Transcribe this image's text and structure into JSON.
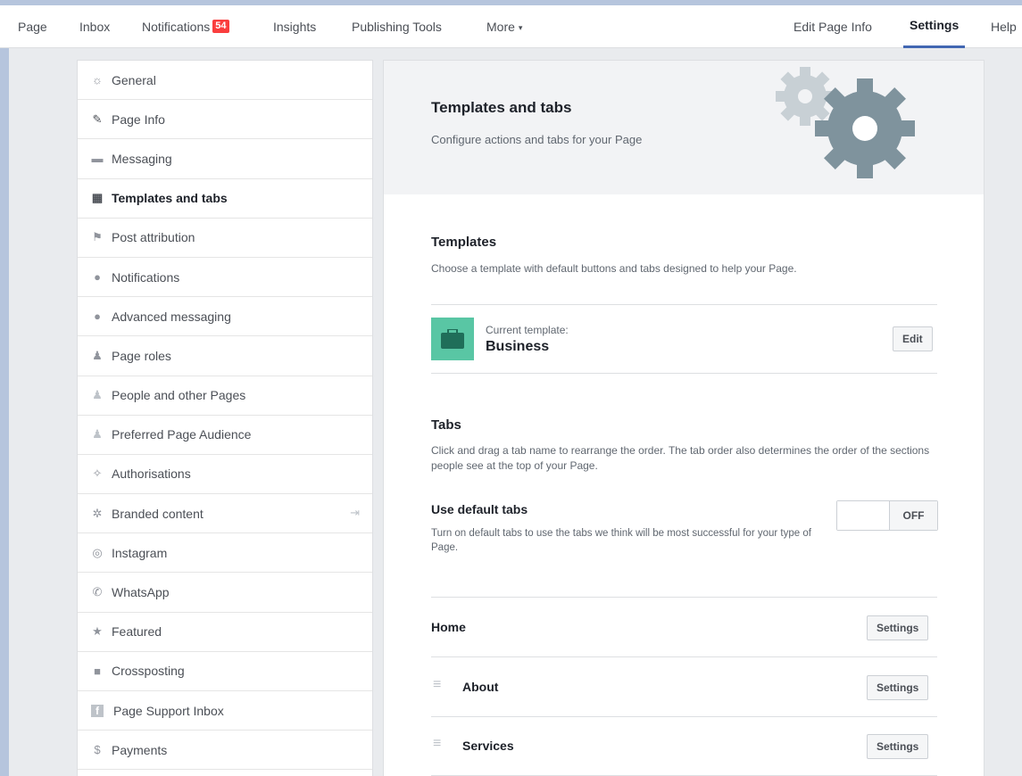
{
  "topnav": {
    "left": [
      {
        "label": "Page"
      },
      {
        "label": "Inbox"
      },
      {
        "label": "Notifications",
        "badge": "54"
      },
      {
        "label": "Insights"
      },
      {
        "label": "Publishing Tools"
      },
      {
        "label": "More"
      }
    ],
    "right": [
      {
        "label": "Edit Page Info"
      },
      {
        "label": "Settings"
      },
      {
        "label": "Help"
      }
    ],
    "more_caret": "▾"
  },
  "sidebar": {
    "items": [
      {
        "label": "General",
        "icon": "gear-icon",
        "glyph": "☼"
      },
      {
        "label": "Page Info",
        "icon": "pencil-icon",
        "glyph": "✎"
      },
      {
        "label": "Messaging",
        "icon": "messaging-icon",
        "glyph": "▬"
      },
      {
        "label": "Templates and tabs",
        "icon": "grid-icon",
        "glyph": "▦"
      },
      {
        "label": "Post attribution",
        "icon": "flag-icon",
        "glyph": "⚑"
      },
      {
        "label": "Notifications",
        "icon": "globe-icon",
        "glyph": "●"
      },
      {
        "label": "Advanced messaging",
        "icon": "messenger-icon",
        "glyph": "●"
      },
      {
        "label": "Page roles",
        "icon": "person-icon",
        "glyph": "♟"
      },
      {
        "label": "People and other Pages",
        "icon": "people-icon",
        "glyph": "♟"
      },
      {
        "label": "Preferred Page Audience",
        "icon": "audience-icon",
        "glyph": "♟"
      },
      {
        "label": "Authorisations",
        "icon": "wrench-icon",
        "glyph": "✧"
      },
      {
        "label": "Branded content",
        "icon": "handshake-icon",
        "glyph": "✲"
      },
      {
        "label": "Instagram",
        "icon": "instagram-icon",
        "glyph": "◎"
      },
      {
        "label": "WhatsApp",
        "icon": "whatsapp-icon",
        "glyph": "✆"
      },
      {
        "label": "Featured",
        "icon": "star-icon",
        "glyph": "★"
      },
      {
        "label": "Crossposting",
        "icon": "video-icon",
        "glyph": "■"
      },
      {
        "label": "Page Support Inbox",
        "icon": "facebook-icon",
        "glyph": "f"
      },
      {
        "label": "Payments",
        "icon": "dollar-icon",
        "glyph": "$"
      }
    ],
    "branded_extra_glyph": "⇥"
  },
  "header": {
    "title": "Templates and tabs",
    "subtitle": "Configure actions and tabs for your Page"
  },
  "templates": {
    "title": "Templates",
    "description": "Choose a template with default buttons and tabs designed to help your Page.",
    "current_label": "Current template:",
    "current_value": "Business",
    "edit_button": "Edit"
  },
  "tabs": {
    "title": "Tabs",
    "description": "Click and drag a tab name to rearrange the order. The tab order also determines the order of the sections people see at the top of your Page.",
    "default_title": "Use default tabs",
    "default_description": "Turn on default tabs to use the tabs we think will be most successful for your type of Page.",
    "toggle_state": "OFF",
    "rows": [
      {
        "label": "Home",
        "button": "Settings"
      },
      {
        "label": "About",
        "button": "Settings"
      },
      {
        "label": "Services",
        "button": "Settings"
      }
    ],
    "drag_glyph": "≡"
  },
  "colors": {
    "accent": "#4267b2",
    "badge": "#fa3e3e",
    "template_icon_bg": "#59c6a4",
    "gear_dark": "#7f939d",
    "gear_light": "#c8d0d5"
  }
}
